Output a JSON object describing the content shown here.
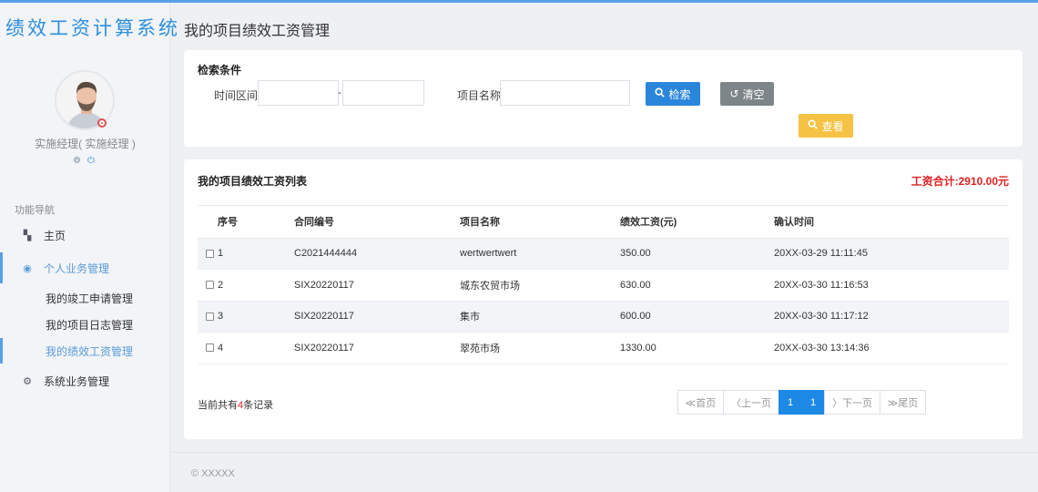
{
  "app": {
    "brand": "绩效工资计算系统",
    "page_title": "我的项目绩效工资管理"
  },
  "user": {
    "name": "实施经理( 实施经理 )",
    "icons": [
      "gear-icon",
      "power-icon"
    ]
  },
  "nav": {
    "title": "功能导航",
    "items": [
      {
        "label": "主页",
        "icon": "dashboard-icon"
      },
      {
        "label": "个人业务管理",
        "icon": "user-circle-icon"
      },
      {
        "label": "系统业务管理",
        "icon": "gears-icon"
      }
    ],
    "sub_items": [
      {
        "label": "我的竣工申请管理"
      },
      {
        "label": "我的项目日志管理"
      },
      {
        "label": "我的绩效工资管理"
      }
    ]
  },
  "search": {
    "heading": "检索条件",
    "time_label": "时间区间",
    "time_separator": "-",
    "start_value": "",
    "end_value": "",
    "project_label": "项目名称",
    "project_value": "",
    "search_btn": "检索",
    "clear_btn": "清空",
    "view_btn": "查看"
  },
  "list": {
    "heading": "我的项目绩效工资列表",
    "total": "工资合计:2910.00元",
    "columns": [
      "序号",
      "合同编号",
      "项目名称",
      "绩效工资(元)",
      "确认时间"
    ],
    "rows": [
      {
        "no": "1",
        "contract": "C2021444444",
        "project": "wertwertwert",
        "salary": "350.00",
        "time": "20XX-03-29 11:11:45"
      },
      {
        "no": "2",
        "contract": "SIX20220117",
        "project": "城东农贸市场",
        "salary": "630.00",
        "time": "20XX-03-30 11:16:53"
      },
      {
        "no": "3",
        "contract": "SIX20220117",
        "project": "集市",
        "salary": "600.00",
        "time": "20XX-03-30 11:17:12"
      },
      {
        "no": "4",
        "contract": "SIX20220117",
        "project": "翠苑市场",
        "salary": "1330.00",
        "time": "20XX-03-30 13:14:36"
      }
    ]
  },
  "record": {
    "prefix": "当前共有",
    "count": "4",
    "suffix": "条记录"
  },
  "pager": {
    "first": "≪首页",
    "prev": "〈上一页",
    "current": "1",
    "total": "1",
    "next": "〉下一页",
    "last": "≫尾页"
  },
  "footer": {
    "copyright": "© XXXXX"
  },
  "colors": {
    "accent": "#2a86da",
    "danger": "#e02020",
    "warning": "#f6c244",
    "neutral": "#7d8589"
  }
}
